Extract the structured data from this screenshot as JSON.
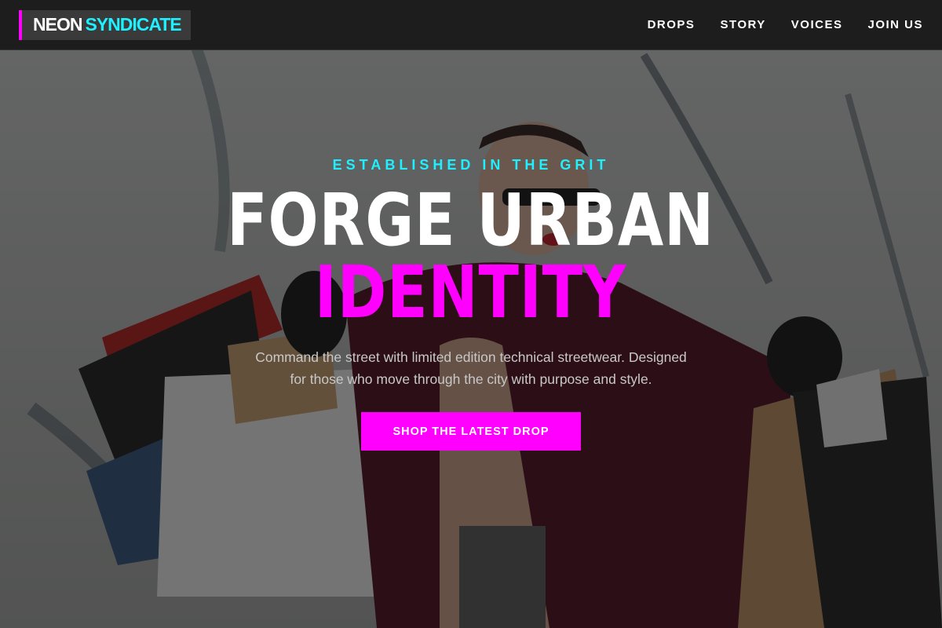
{
  "brand": {
    "word1": "NEON",
    "word2": "SYNDICATE"
  },
  "nav": {
    "items": [
      {
        "label": "DROPS"
      },
      {
        "label": "STORY"
      },
      {
        "label": "VOICES"
      },
      {
        "label": "JOIN US"
      }
    ]
  },
  "hero": {
    "kicker": "ESTABLISHED IN THE GRIT",
    "headline_line1": "FORGE URBAN",
    "headline_line2": "IDENTITY",
    "subtext": "Command the street with limited edition technical streetwear. Designed for those who move through the city with purpose and style.",
    "cta_label": "SHOP THE LATEST DROP"
  },
  "colors": {
    "accent_magenta": "#ff00ff",
    "accent_cyan": "#1ff0ff",
    "nav_background": "#1d1d1d"
  }
}
